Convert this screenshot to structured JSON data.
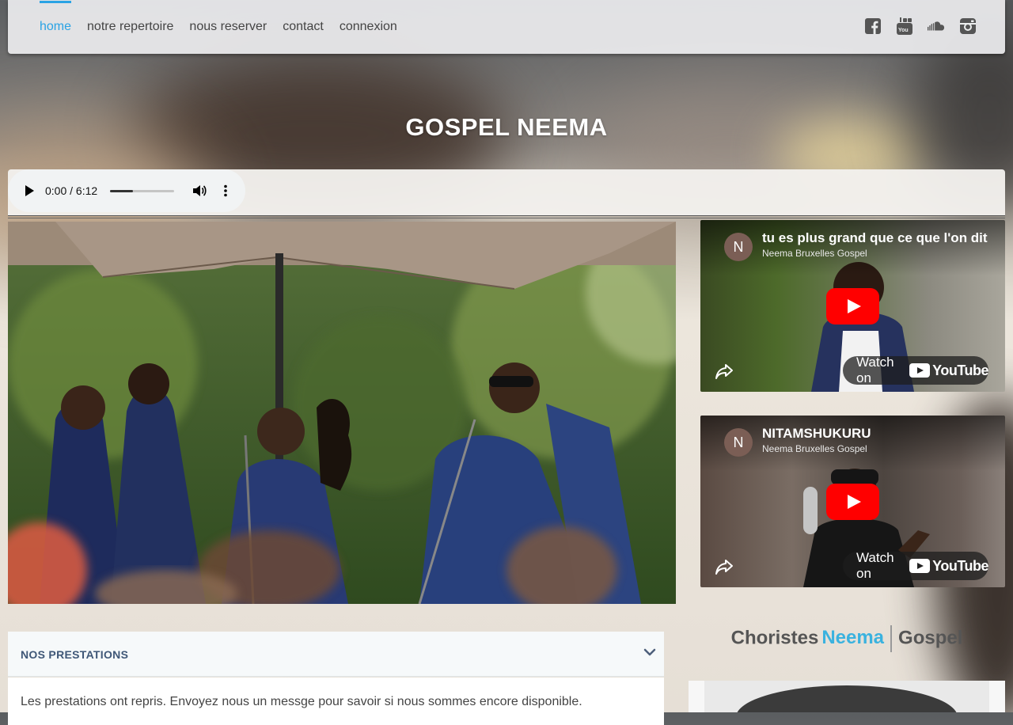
{
  "nav": {
    "items": [
      {
        "label": "home",
        "active": true
      },
      {
        "label": "notre repertoire",
        "active": false
      },
      {
        "label": "nous reserver",
        "active": false
      },
      {
        "label": "contact",
        "active": false
      },
      {
        "label": "connexion",
        "active": false
      }
    ],
    "social_icons": [
      "facebook-icon",
      "youtube-icon",
      "soundcloud-icon",
      "instagram-icon"
    ],
    "active_color": "#2aa3e4"
  },
  "hero": {
    "title": "GOSPEL NEEMA"
  },
  "audio": {
    "time": "0:00 / 6:12",
    "progress": 0.36
  },
  "main_photo": {
    "alt_icon": "choir-singers-photo"
  },
  "videos": [
    {
      "avatar": "N",
      "title": "tu es plus grand que ce que l'on dit",
      "channel": "Neema Bruxelles Gospel",
      "watch_label": "Watch on",
      "brand": "YouTube"
    },
    {
      "avatar": "N",
      "title": "NITAMSHUKURU",
      "channel": "Neema Bruxelles Gospel",
      "watch_label": "Watch on",
      "brand": "YouTube"
    }
  ],
  "prestations": {
    "title": "NOS PRESTATIONS",
    "text": "Les prestations ont repris. Envoyez nous un messge pour savoir si nous sommes encore disponible."
  },
  "choristes": {
    "part1": "Choristes",
    "part2": "Neema",
    "part3": "Gospel"
  },
  "colors": {
    "brand_blue": "#3ab2df",
    "youtube_red": "#ff0000"
  }
}
